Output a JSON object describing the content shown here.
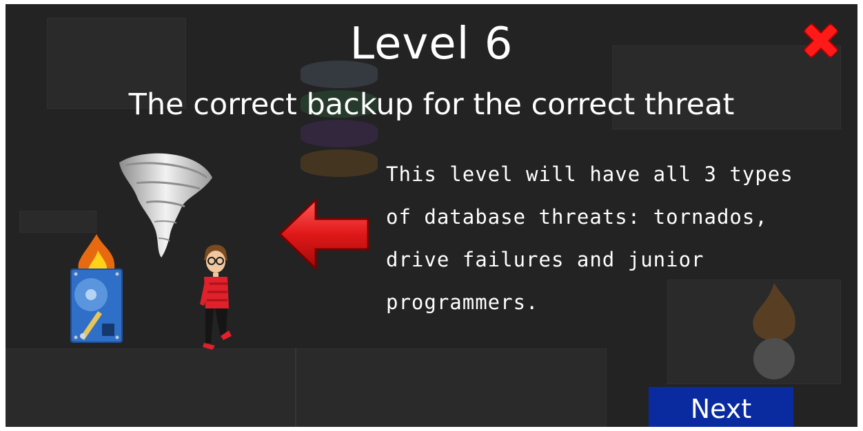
{
  "level": {
    "title": "Level 6",
    "subtitle": "The correct backup for the correct threat",
    "description": "This level will have all 3 types\nof database threats: tornados,\ndrive failures and junior\nprogrammers."
  },
  "buttons": {
    "next_label": "Next"
  },
  "icons": {
    "close": "close-x-icon",
    "arrow": "left-arrow-icon",
    "tornado": "tornado-icon",
    "drive": "burning-hard-drive-icon",
    "programmer": "junior-programmer-icon"
  },
  "colors": {
    "background": "#232323",
    "close": "#e01010",
    "arrow": "#e01818",
    "next_button": "#0a2aa0",
    "text": "#ffffff"
  }
}
